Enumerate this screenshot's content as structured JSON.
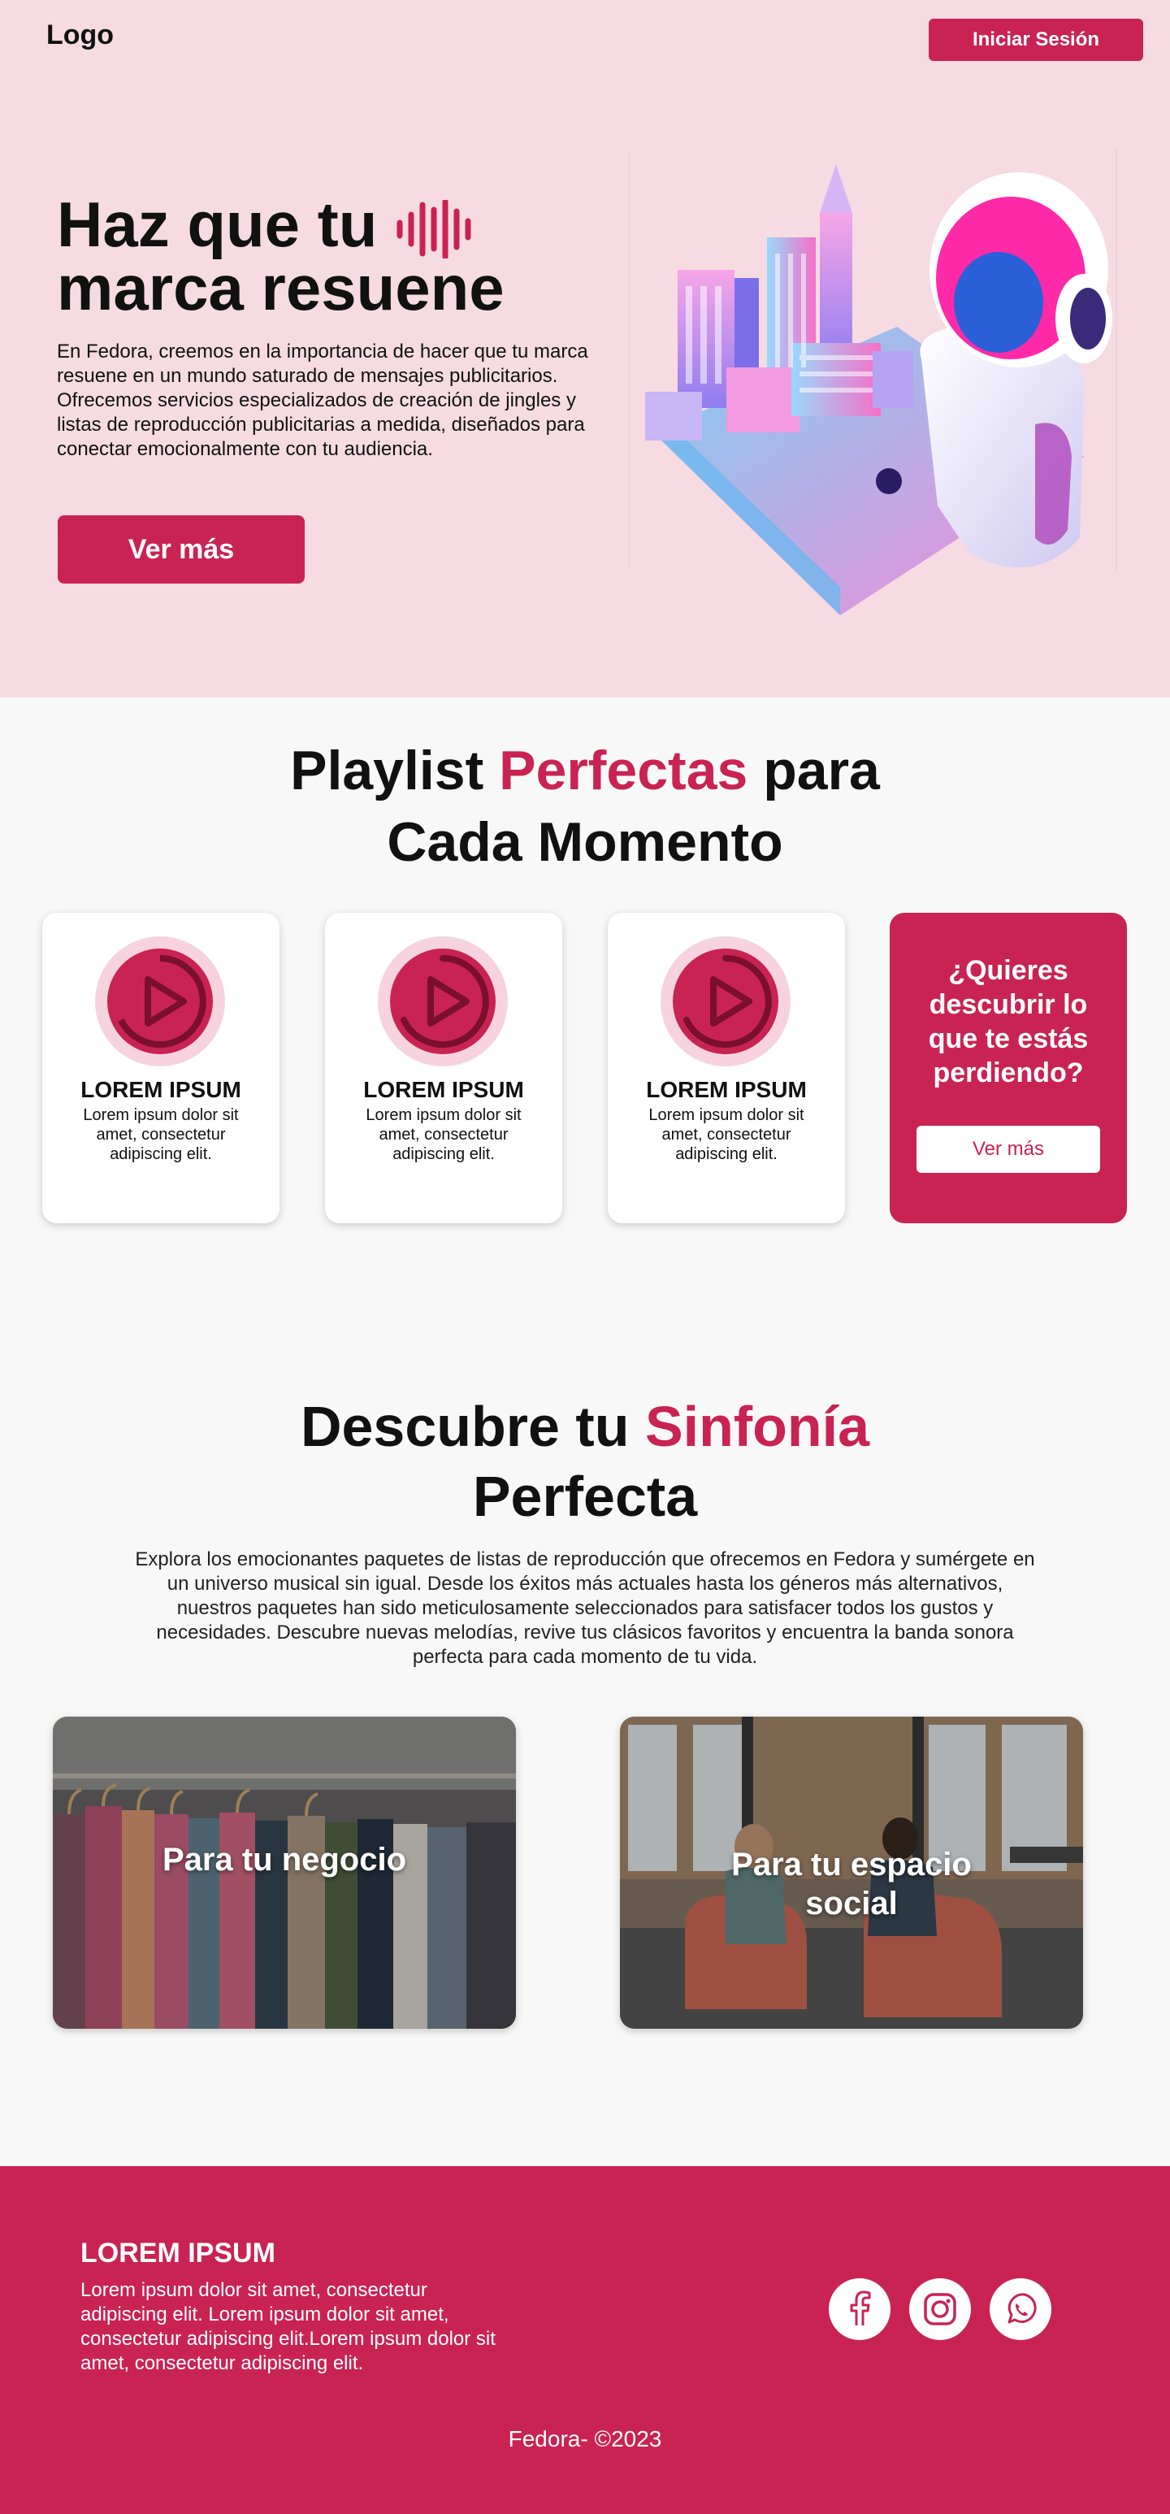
{
  "header": {
    "logo": "Logo",
    "login_label": "Iniciar Sesión"
  },
  "hero": {
    "title_line1": "Haz que tu",
    "title_line2": "marca resuene",
    "text": "En Fedora, creemos en la importancia de hacer que tu marca resuene en un mundo saturado de mensajes publicitarios. Ofrecemos servicios especializados de creación de jingles y listas de reproducción publicitarias a medida, diseñados para conectar emocionalmente con tu audiencia.",
    "button_label": "Ver más"
  },
  "playlists": {
    "title_prefix": "Playlist ",
    "title_accent": "Perfectas",
    "title_suffix": " para",
    "title_line2": "Cada Momento",
    "cards": [
      {
        "title": "LOREM IPSUM",
        "text": "Lorem ipsum dolor sit amet, consectetur adipiscing elit."
      },
      {
        "title": "LOREM IPSUM",
        "text": "Lorem ipsum dolor sit amet, consectetur adipiscing elit."
      },
      {
        "title": "LOREM IPSUM",
        "text": "Lorem ipsum dolor sit amet, consectetur adipiscing elit."
      }
    ],
    "cta_title": "¿Quieres descubrir lo que te estás perdiendo?",
    "cta_button": "Ver más"
  },
  "discover": {
    "title_prefix": "Descubre tu ",
    "title_accent": "Sinfonía",
    "title_line2": "Perfecta",
    "text": "Explora los emocionantes paquetes de listas de reproducción que ofrecemos en Fedora y sumérgete en un universo musical sin igual. Desde los éxitos más actuales hasta los géneros más alternativos, nuestros paquetes han sido meticulosamente seleccionados para satisfacer todos los gustos y necesidades. Descubre nuevas melodías, revive tus clásicos favoritos y encuentra la banda sonora perfecta para cada momento de tu vida.",
    "business_label": "Para tu negocio",
    "social_label_line1": "Para tu espacio",
    "social_label_line2": "social"
  },
  "footer": {
    "title": "LOREM IPSUM",
    "text": "Lorem ipsum dolor sit amet, consectetur adipiscing elit. Lorem ipsum dolor sit amet, consectetur adipiscing elit.Lorem ipsum dolor sit amet, consectetur adipiscing elit.",
    "icons": [
      "facebook-icon",
      "instagram-icon",
      "whatsapp-icon"
    ],
    "copyright": "Fedora- ©2023"
  },
  "colors": {
    "accent": "#c92353",
    "hero_background": "#f6dbe3",
    "page_background": "#f8f8f8"
  }
}
